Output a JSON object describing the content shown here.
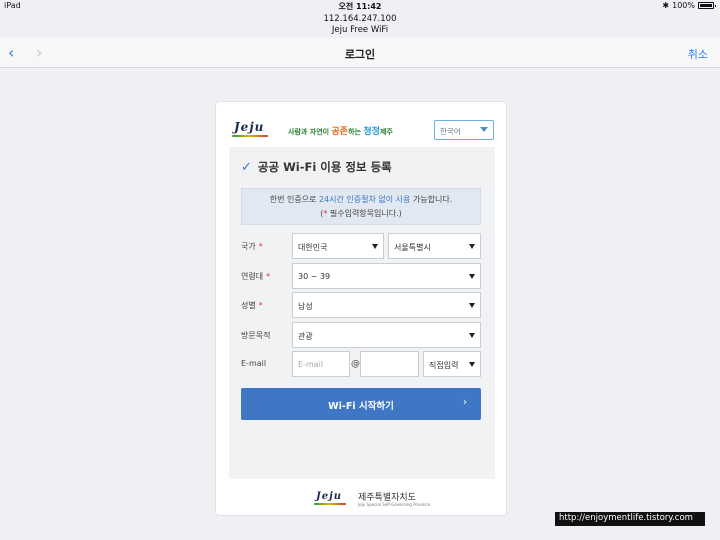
{
  "status_bar": {
    "device": "iPad",
    "time": "오전 11:42",
    "battery": "100%"
  },
  "address": {
    "url": "112.164.247.100",
    "page_title": "Jeju Free WiFi"
  },
  "navbar": {
    "title": "로그인",
    "cancel": "취소",
    "back_icon": "‹",
    "forward_icon": "›"
  },
  "header": {
    "logo_text": "Jeju",
    "slogan": {
      "part1": "사람과 자연이 ",
      "part2": "공존",
      "part3": "하는 ",
      "part4": "청정",
      "part5": "제주"
    },
    "language": "한국어"
  },
  "form": {
    "title": "공공 Wi-Fi 이용 정보 등록",
    "notice_pre": "한번 인증으로 ",
    "notice_highlight": "24시간 인증절차 없이 사용",
    "notice_post": " 가능합니다.",
    "notice_line2_pre": "(",
    "notice_star": "*",
    "notice_line2_post": " 필수입력항목입니다.)",
    "fields": {
      "country": {
        "label": "국가",
        "value": "대한민국",
        "region": "서울특별시"
      },
      "age": {
        "label": "연령대",
        "value": "30 ~ 39"
      },
      "gender": {
        "label": "성별",
        "value": "남성"
      },
      "purpose": {
        "label": "방문목적",
        "value": "관광"
      },
      "email": {
        "label": "E-mail",
        "placeholder": "E-mail",
        "at": "@",
        "domain": "직접입력"
      }
    },
    "required_mark": "*",
    "submit": "Wi-Fi 시작하기",
    "submit_chevron": "›"
  },
  "footer": {
    "logo_text": "Jeju",
    "org": "제주특별자치도",
    "org_sub": "Jeju Special Self-Governing Province"
  },
  "watermark": "http://enjoymentlife.tistory.com"
}
